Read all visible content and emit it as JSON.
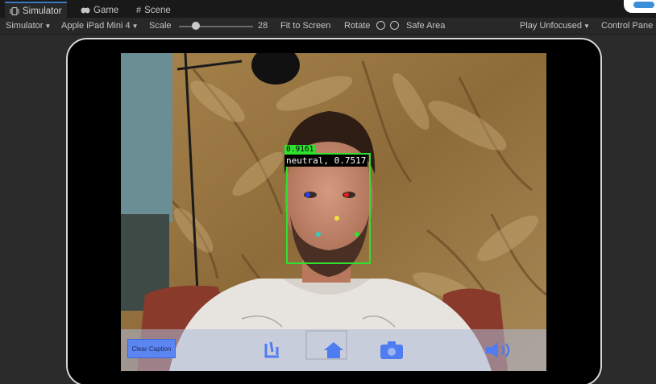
{
  "tabs": [
    {
      "label": "Simulator",
      "icon": "device-icon",
      "active": true
    },
    {
      "label": "Game",
      "icon": "gamepad-icon",
      "active": false
    },
    {
      "label": "Scene",
      "icon": "hash-icon",
      "active": false
    }
  ],
  "toolbar": {
    "mode_label": "Simulator",
    "device_label": "Apple iPad Mini 4",
    "scale_label": "Scale",
    "scale_value": "28",
    "fit_label": "Fit to Screen",
    "rotate_label": "Rotate",
    "safe_area_label": "Safe Area",
    "play_label": "Play Unfocused",
    "control_label": "Control Pane"
  },
  "detection": {
    "confidence": "0.9161",
    "emotion": "neutral, 0.7517"
  },
  "bottom_bar": {
    "clear_button_label": "Clear Caption",
    "icons": [
      "flip-camera-icon",
      "home-icon",
      "camera-icon",
      "speaker-icon"
    ]
  },
  "colors": {
    "accent": "#3a79bb",
    "detection_box": "#2fe02f",
    "bottom_icons": "#4f7cf0",
    "clear_button": "#5b86f2"
  }
}
